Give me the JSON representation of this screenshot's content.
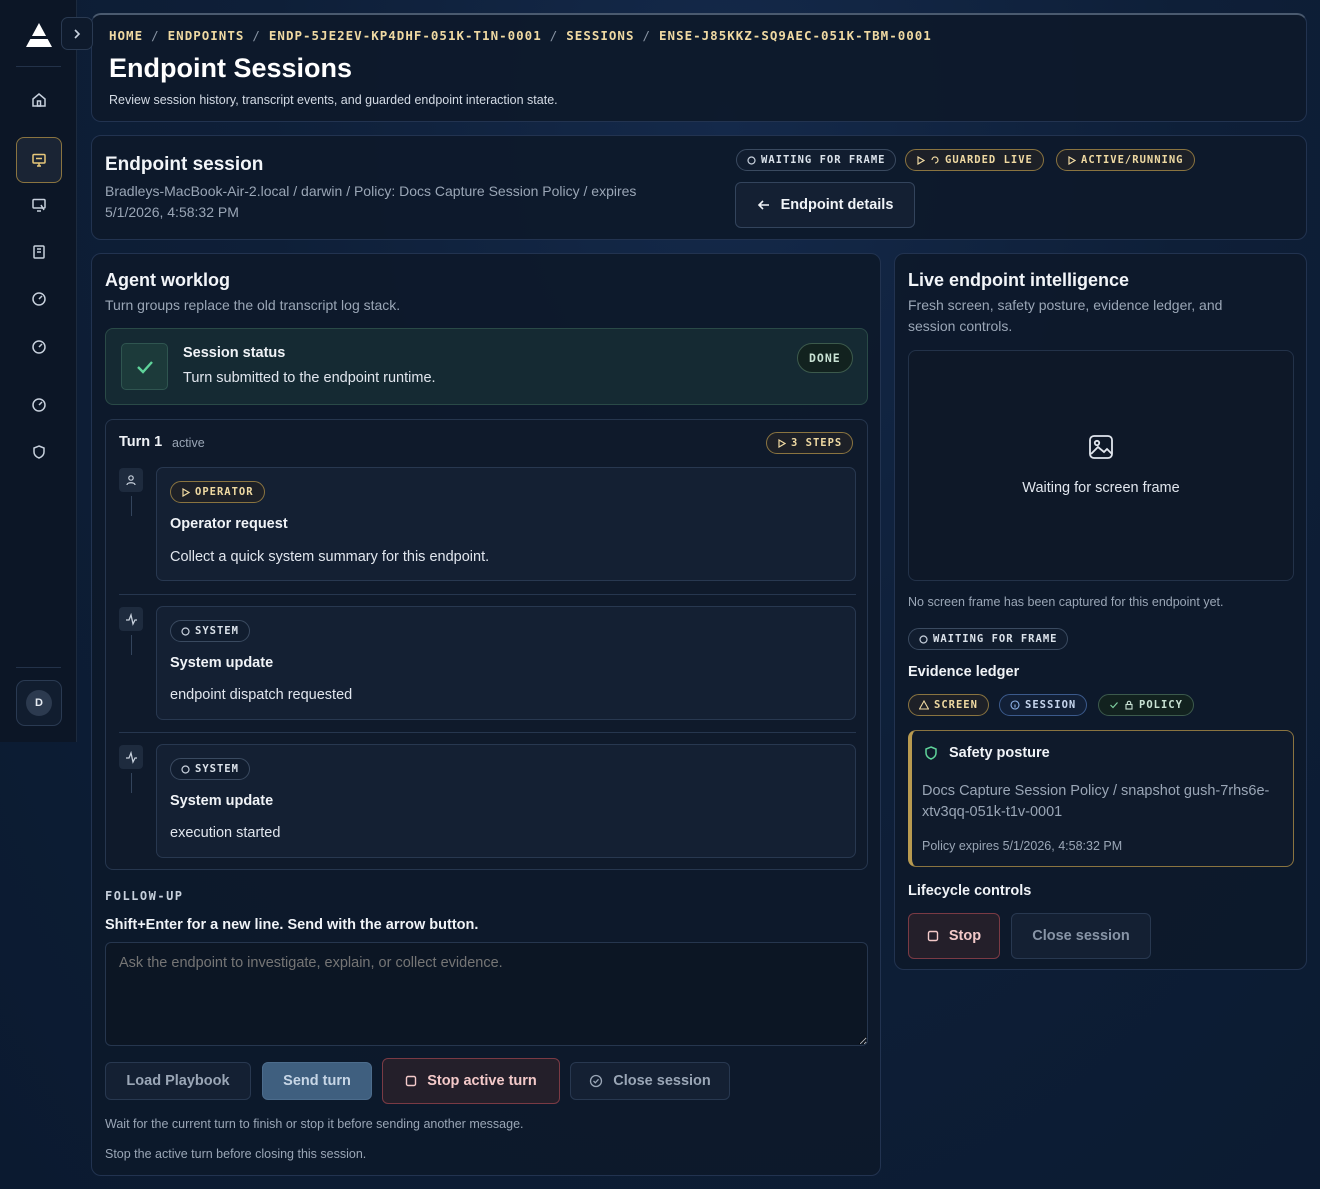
{
  "breadcrumb": [
    "HOME",
    "ENDPOINTS",
    "ENDP-5JE2EV-KP4DHF-051K-T1N-0001",
    "SESSIONS",
    "ENSE-J85KKZ-SQ9AEC-051K-TBM-0001"
  ],
  "header": {
    "title": "Endpoint Sessions",
    "subtitle": "Review session history, transcript events, and guarded endpoint interaction state."
  },
  "session": {
    "title": "Endpoint session",
    "meta_line1": "Bradleys-MacBook-Air-2.local / darwin / Policy: Docs Capture Session Policy / expires",
    "meta_line2": "5/1/2026, 4:58:32 PM",
    "badges": [
      "WAITING FOR FRAME",
      "GUARDED LIVE",
      "ACTIVE/RUNNING"
    ],
    "details_button": "Endpoint details"
  },
  "worklog": {
    "title": "Agent worklog",
    "subtitle": "Turn groups replace the old transcript log stack.",
    "status": {
      "title": "Session status",
      "text": "Turn submitted to the endpoint runtime.",
      "badge": "DONE"
    },
    "turn": {
      "label": "Turn 1",
      "state": "active",
      "steps_badge": "3 STEPS",
      "steps": [
        {
          "tag": "OPERATOR",
          "title": "Operator request",
          "text": "Collect a quick system summary for this endpoint.",
          "icon": "user-icon"
        },
        {
          "tag": "SYSTEM",
          "title": "System update",
          "text": "endpoint dispatch requested",
          "icon": "activity-icon"
        },
        {
          "tag": "SYSTEM",
          "title": "System update",
          "text": "execution started",
          "icon": "activity-icon"
        }
      ]
    },
    "followup": {
      "label": "FOLLOW-UP",
      "hint": "Shift+Enter for a new line. Send with the arrow button.",
      "placeholder": "Ask the endpoint to investigate, explain, or collect evidence."
    },
    "actions": {
      "load_playbook": "Load Playbook",
      "send_turn": "Send turn",
      "stop_active_turn": "Stop active turn",
      "close_session": "Close session"
    },
    "notes": [
      "Wait for the current turn to finish or stop it before sending another message.",
      "Stop the active turn before closing this session."
    ]
  },
  "intel": {
    "title": "Live endpoint intelligence",
    "subtitle_line1": "Fresh screen, safety posture, evidence ledger, and",
    "subtitle_line2": "session controls.",
    "frame_text": "Waiting for screen frame",
    "no_frame_note": "No screen frame has been captured for this endpoint yet.",
    "frame_badge": "WAITING FOR FRAME",
    "evidence_title": "Evidence ledger",
    "evidence_badges": [
      "SCREEN",
      "SESSION",
      "POLICY"
    ],
    "posture": {
      "title": "Safety posture",
      "line1": "Docs Capture Session Policy / snapshot gush-7rhs6e-",
      "line2": "xtv3qq-051k-t1v-0001",
      "expires": "Policy expires 5/1/2026, 4:58:32 PM"
    },
    "lifecycle_title": "Lifecycle controls",
    "stop": "Stop",
    "close_session": "Close session"
  },
  "user": {
    "initial": "D"
  },
  "colors": {
    "accent_gold": "#efd9a2",
    "danger": "#f3c9c9",
    "success": "#5fd39a"
  }
}
